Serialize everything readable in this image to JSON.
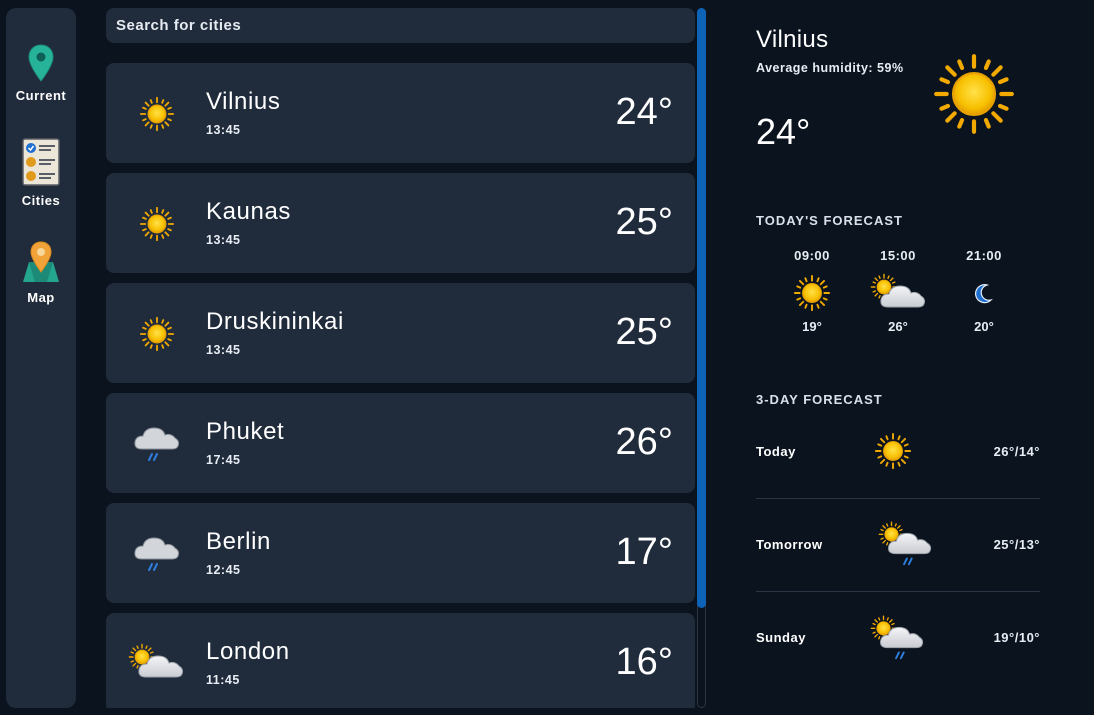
{
  "sidebar": {
    "items": [
      {
        "label": "Current",
        "icon": "map-pin-icon"
      },
      {
        "label": "Cities",
        "icon": "checklist-icon"
      },
      {
        "label": "Map",
        "icon": "map-icon"
      }
    ]
  },
  "search": {
    "placeholder": "Search for cities"
  },
  "cities": [
    {
      "name": "Vilnius",
      "time": "13:45",
      "temp": "24°",
      "icon": "sun-icon"
    },
    {
      "name": "Kaunas",
      "time": "13:45",
      "temp": "25°",
      "icon": "sun-icon"
    },
    {
      "name": "Druskininkai",
      "time": "13:45",
      "temp": "25°",
      "icon": "sun-icon"
    },
    {
      "name": "Phuket",
      "time": "17:45",
      "temp": "26°",
      "icon": "rain-cloud-icon"
    },
    {
      "name": "Berlin",
      "time": "12:45",
      "temp": "17°",
      "icon": "rain-cloud-icon"
    },
    {
      "name": "London",
      "time": "11:45",
      "temp": "16°",
      "icon": "partly-cloudy-icon"
    }
  ],
  "current": {
    "city": "Vilnius",
    "humidity": "Average humidity: 59%",
    "temp": "24°",
    "icon": "sun-icon"
  },
  "today_forecast": {
    "title": "TODAY'S FORECAST",
    "hours": [
      {
        "time": "09:00",
        "temp": "19°",
        "icon": "sun-icon"
      },
      {
        "time": "15:00",
        "temp": "26°",
        "icon": "partly-cloudy-icon"
      },
      {
        "time": "21:00",
        "temp": "20°",
        "icon": "moon-icon"
      }
    ]
  },
  "three_day": {
    "title": "3-DAY FORECAST",
    "days": [
      {
        "day": "Today",
        "temps": "26°/14°",
        "icon": "sun-icon"
      },
      {
        "day": "Tomorrow",
        "temps": "25°/13°",
        "icon": "partly-cloudy-rain-icon"
      },
      {
        "day": "Sunday",
        "temps": "19°/10°",
        "icon": "partly-cloudy-rain-icon"
      }
    ]
  },
  "colors": {
    "background": "#0b131e",
    "card": "#202b3b",
    "accent": "#0f63b7",
    "sun": "#f8c000"
  }
}
